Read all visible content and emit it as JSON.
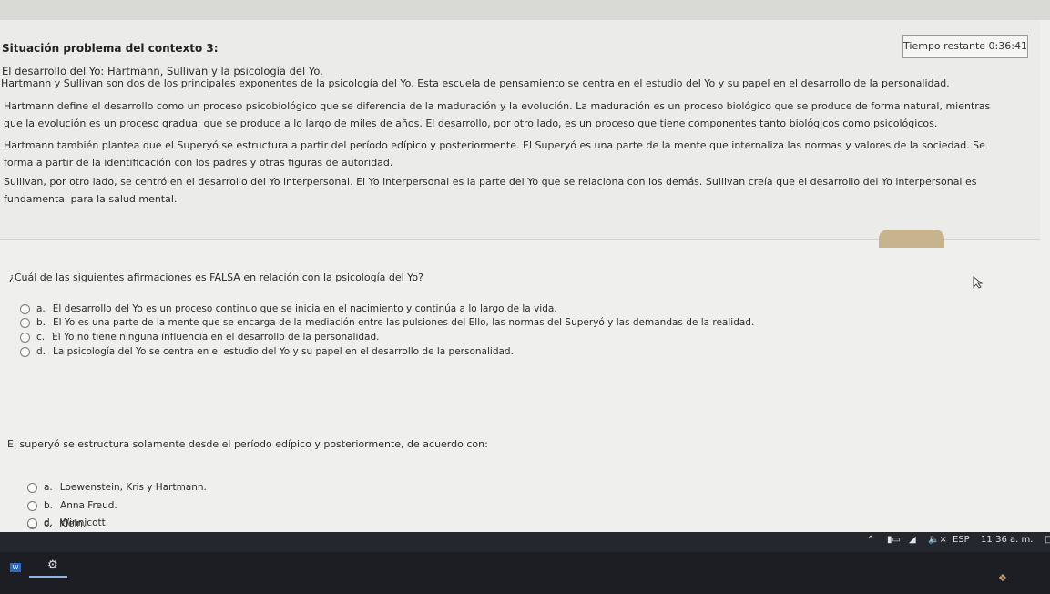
{
  "header": {
    "title": "Situación problema del contexto 3:",
    "timer": "Tiempo restante 0:36:41",
    "subtitle": "El desarrollo del Yo: Hartmann, Sullivan y la psicología del Yo."
  },
  "paragraphs": [
    "Hartmann y Sullivan son dos de los principales exponentes de la psicología del Yo. Esta escuela de pensamiento se centra en el estudio del Yo y su papel en el desarrollo de la personalidad.",
    "Hartmann define el desarrollo como un proceso psicobiológico que se diferencia de la maduración y la evolución. La maduración es un proceso biológico que se produce de forma natural, mientras que la evolución es un proceso gradual que se produce a lo largo de miles de años. El desarrollo, por otro lado, es un proceso que tiene componentes tanto biológicos como psicológicos.",
    "Hartmann también plantea que el Superyó se estructura a partir del período edípico y posteriormente. El Superyó es una parte de la mente que internaliza las normas y valores de la sociedad. Se forma a partir de la identificación con los padres y otras figuras de autoridad.",
    "Sullivan, por otro lado, se centró en el desarrollo del Yo interpersonal. El Yo interpersonal es la parte del Yo que se relaciona con los demás. Sullivan creía que el desarrollo del Yo interpersonal es fundamental para la salud mental."
  ],
  "question1": {
    "text": "¿Cuál de las siguientes afirmaciones es FALSA en relación con la psicología del Yo?",
    "options": [
      {
        "letter": "a.",
        "text": "El desarrollo del Yo es un proceso continuo que se inicia en el nacimiento y continúa a lo largo de la vida."
      },
      {
        "letter": "b.",
        "text": "El Yo es una parte de la mente que se encarga de la mediación entre las pulsiones del Ello, las normas del Superyó y las demandas de la realidad."
      },
      {
        "letter": "c.",
        "text": "El Yo no tiene ninguna influencia en el desarrollo de la personalidad."
      },
      {
        "letter": "d.",
        "text": "La psicología del Yo se centra en el estudio del Yo y su papel en el desarrollo de la personalidad."
      }
    ]
  },
  "question2": {
    "text": "El superyó se estructura solamente desde el período edípico y posteriormente, de acuerdo con:",
    "options": [
      {
        "letter": "a.",
        "text": "Loewenstein, Kris y Hartmann."
      },
      {
        "letter": "b.",
        "text": "Anna Freud."
      },
      {
        "letter": "c.",
        "text": "Klein."
      },
      {
        "letter": "d.",
        "text": "Winnicott."
      }
    ]
  },
  "taskbar": {
    "language": "ESP",
    "clock": "11:36 a. m.",
    "word_app_label": "W"
  }
}
